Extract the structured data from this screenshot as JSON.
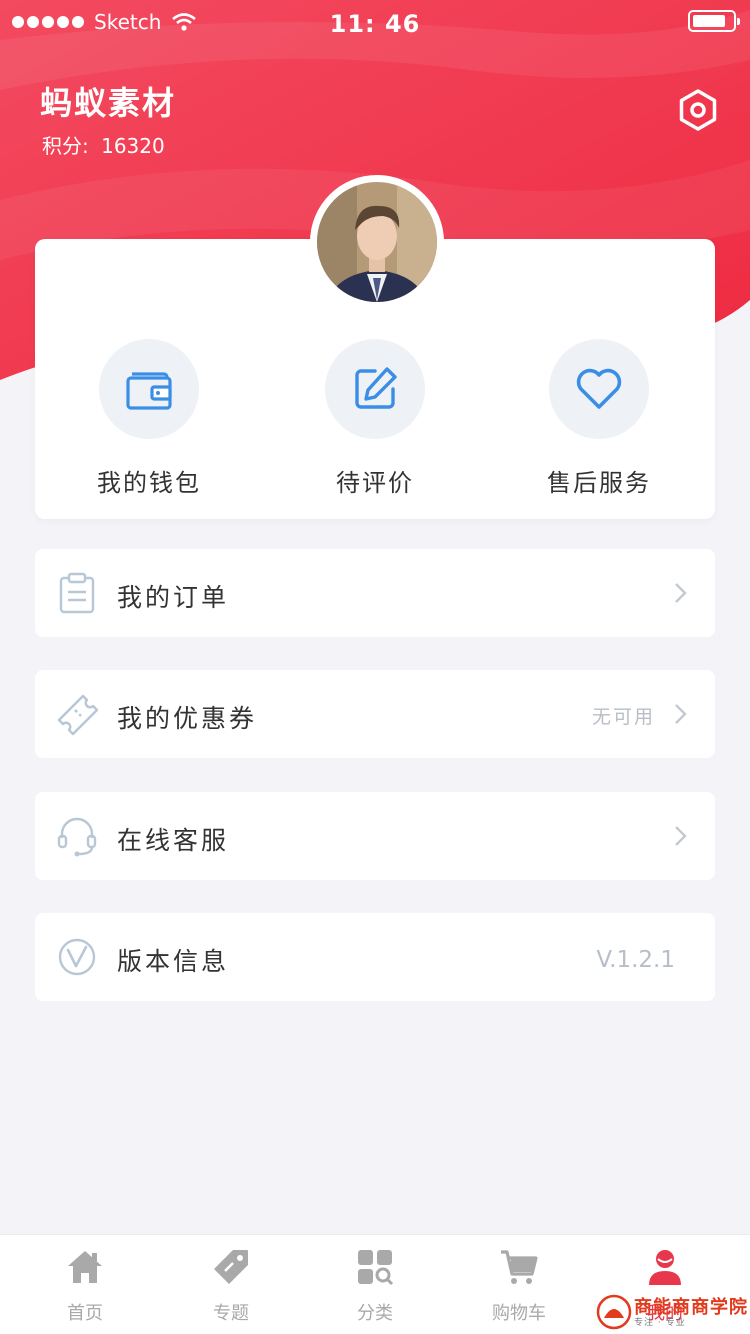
{
  "status_bar": {
    "carrier": "Sketch",
    "time": "11: 46"
  },
  "profile": {
    "name": "蚂蚁素材",
    "points_label": "积分:",
    "points_value": "16320"
  },
  "icons": {
    "settings": "hexagon-gear-icon",
    "avatar": "user-photo"
  },
  "quick_actions": [
    {
      "label": "我的钱包",
      "icon": "wallet-icon"
    },
    {
      "label": "待评价",
      "icon": "edit-icon"
    },
    {
      "label": "售后服务",
      "icon": "heart-icon"
    }
  ],
  "menu": [
    {
      "label": "我的订单",
      "icon": "clipboard-icon",
      "aside": ""
    },
    {
      "label": "我的优惠券",
      "icon": "ticket-icon",
      "aside": "无可用"
    },
    {
      "label": "在线客服",
      "icon": "headset-icon",
      "aside": ""
    },
    {
      "label": "版本信息",
      "icon": "version-icon",
      "aside": "V.1.2.1"
    }
  ],
  "tabs": [
    {
      "label": "首页",
      "icon": "home-icon"
    },
    {
      "label": "专题",
      "icon": "tag-icon"
    },
    {
      "label": "分类",
      "icon": "category-icon"
    },
    {
      "label": "购物车",
      "icon": "cart-icon"
    },
    {
      "label": "我的",
      "icon": "user-icon"
    }
  ],
  "watermark": {
    "text": "商能商商学院",
    "sub": "专注 · 专业"
  },
  "colors": {
    "brand_red": "#f0354b",
    "icon_blue": "#3a8ee6",
    "muted": "#b7bec6"
  }
}
